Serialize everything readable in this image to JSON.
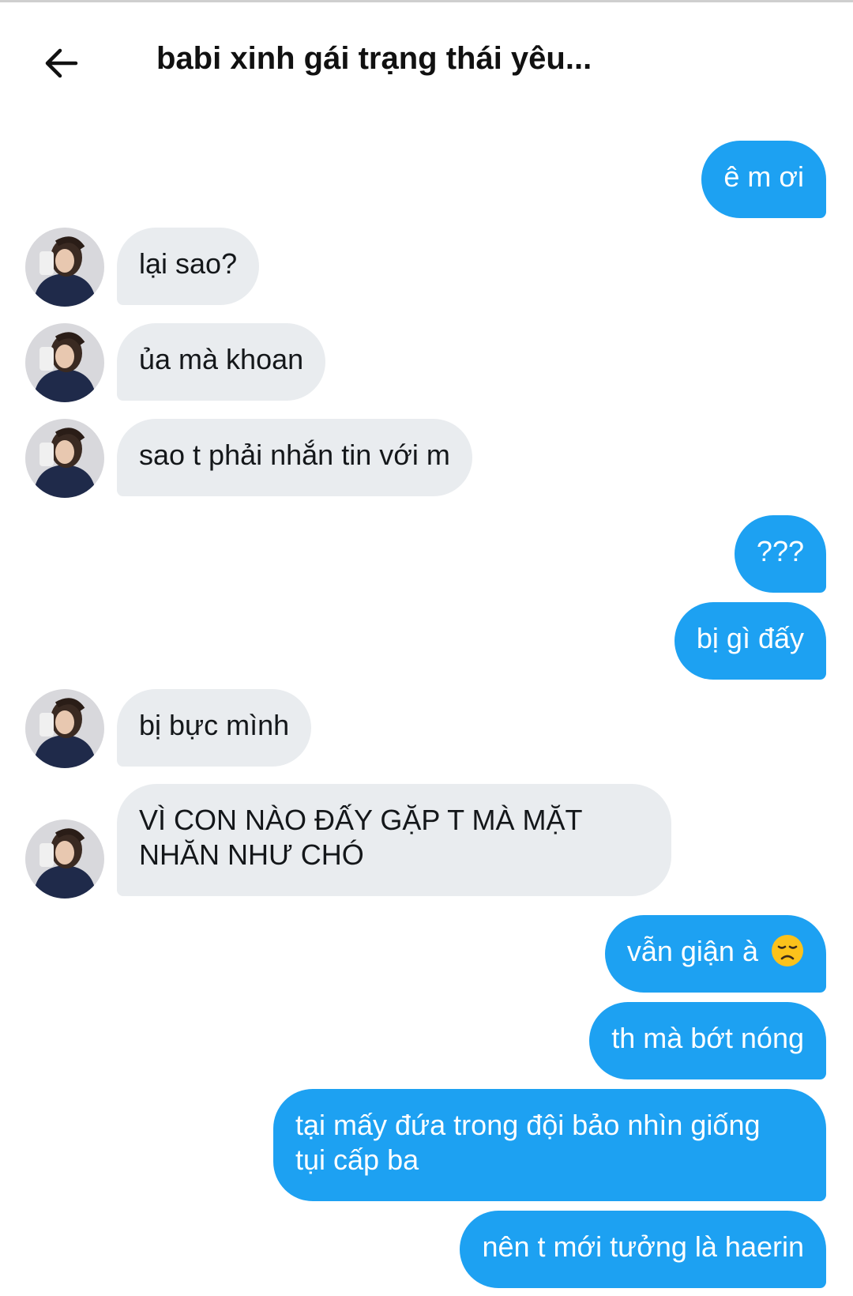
{
  "header": {
    "title": "babi xinh gái trạng thái yêu..."
  },
  "messages": [
    {
      "from": "me",
      "text": "ê m ơi"
    },
    {
      "from": "them",
      "text": "lại sao?"
    },
    {
      "from": "them",
      "text": "ủa mà khoan"
    },
    {
      "from": "them",
      "text": "sao t phải nhắn tin với m"
    },
    {
      "from": "me",
      "text": "???"
    },
    {
      "from": "me",
      "text": "bị gì đấy"
    },
    {
      "from": "them",
      "text": "bị bực mình"
    },
    {
      "from": "them",
      "line1": "VÌ CON NÀO ĐẤY GẶP T MÀ MẶT",
      "line2": "NHĂN NHƯ CHÓ"
    },
    {
      "from": "me",
      "text": "vẫn giận à",
      "emoji": "disappointed-face"
    },
    {
      "from": "me",
      "text": "th mà bớt nóng"
    },
    {
      "from": "me",
      "line1": "tại mấy đứa trong đội bảo nhìn giống",
      "line2": "tụi cấp ba"
    },
    {
      "from": "me",
      "text": "nên t mới tưởng là haerin"
    }
  ],
  "colors": {
    "sent_bubble": "#1da1f2",
    "received_bubble": "#e9ecef",
    "sent_text": "#ffffff",
    "received_text": "#14171a"
  },
  "icons": {
    "back": "arrow-left-icon",
    "avatar": "profile-photo"
  }
}
